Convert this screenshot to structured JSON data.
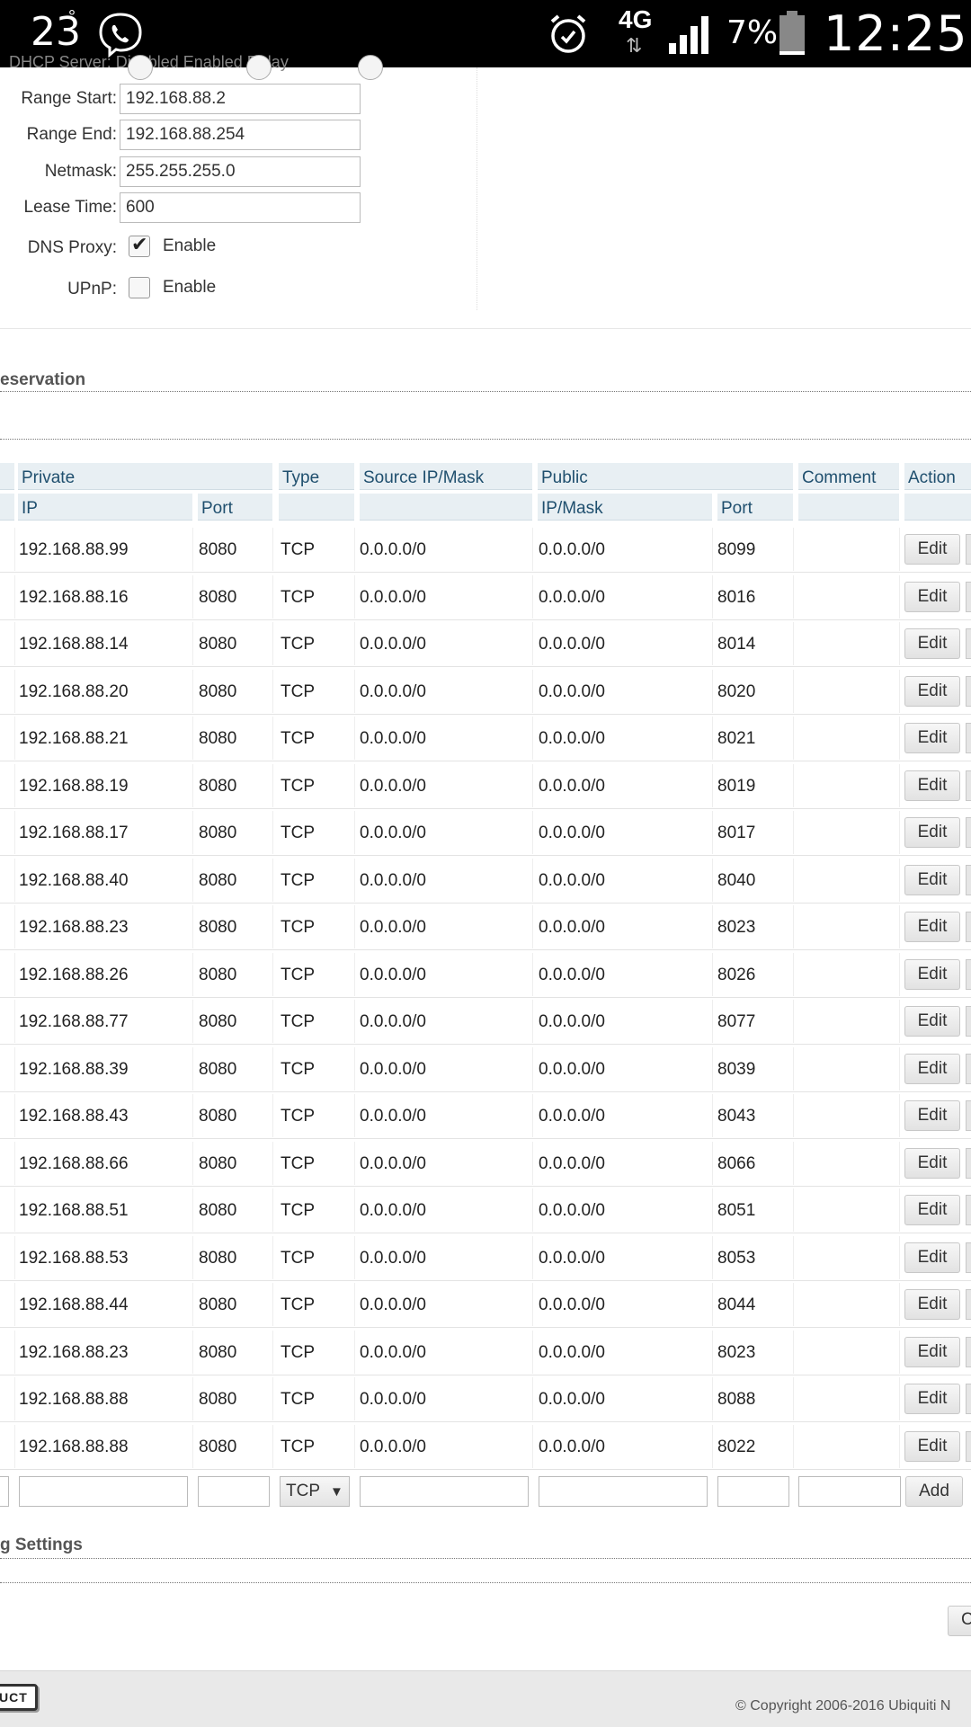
{
  "status_bar": {
    "temperature": "23",
    "degree": "°",
    "network": "4G",
    "network_arrows": "⇅",
    "battery_percent": "7%",
    "time": "12:25",
    "icons": [
      "viber-icon",
      "alarm-icon",
      "signal-icon",
      "battery-icon"
    ]
  },
  "dhcp": {
    "cut_row_text": "DHCP Server:   Disabled   Enabled   Relay",
    "fields": [
      {
        "label": "Range Start:",
        "value": "192.168.88.2"
      },
      {
        "label": "Range End:",
        "value": "192.168.88.254"
      },
      {
        "label": "Netmask:",
        "value": "255.255.255.0"
      },
      {
        "label": "Lease Time:",
        "value": "600"
      }
    ],
    "dns_proxy": {
      "label": "DNS Proxy:",
      "option": "Enable",
      "checked": true
    },
    "upnp": {
      "label": "UPnP:",
      "option": "Enable",
      "checked": false
    }
  },
  "reservation_title": "eservation",
  "settings_title": "g Settings",
  "table": {
    "headers_top": {
      "private": "Private",
      "type": "Type",
      "source": "Source IP/Mask",
      "public": "Public",
      "comment": "Comment",
      "action": "Action"
    },
    "headers_sub": {
      "ip": "IP",
      "port": "Port",
      "public_ip": "IP/Mask",
      "public_port": "Port"
    },
    "edit_label": "Edit",
    "rows": [
      {
        "ip": "192.168.88.99",
        "port": "8080",
        "type": "TCP",
        "source": "0.0.0.0/0",
        "public_ip": "0.0.0.0/0",
        "public_port": "8099"
      },
      {
        "ip": "192.168.88.16",
        "port": "8080",
        "type": "TCP",
        "source": "0.0.0.0/0",
        "public_ip": "0.0.0.0/0",
        "public_port": "8016"
      },
      {
        "ip": "192.168.88.14",
        "port": "8080",
        "type": "TCP",
        "source": "0.0.0.0/0",
        "public_ip": "0.0.0.0/0",
        "public_port": "8014"
      },
      {
        "ip": "192.168.88.20",
        "port": "8080",
        "type": "TCP",
        "source": "0.0.0.0/0",
        "public_ip": "0.0.0.0/0",
        "public_port": "8020"
      },
      {
        "ip": "192.168.88.21",
        "port": "8080",
        "type": "TCP",
        "source": "0.0.0.0/0",
        "public_ip": "0.0.0.0/0",
        "public_port": "8021"
      },
      {
        "ip": "192.168.88.19",
        "port": "8080",
        "type": "TCP",
        "source": "0.0.0.0/0",
        "public_ip": "0.0.0.0/0",
        "public_port": "8019"
      },
      {
        "ip": "192.168.88.17",
        "port": "8080",
        "type": "TCP",
        "source": "0.0.0.0/0",
        "public_ip": "0.0.0.0/0",
        "public_port": "8017"
      },
      {
        "ip": "192.168.88.40",
        "port": "8080",
        "type": "TCP",
        "source": "0.0.0.0/0",
        "public_ip": "0.0.0.0/0",
        "public_port": "8040"
      },
      {
        "ip": "192.168.88.23",
        "port": "8080",
        "type": "TCP",
        "source": "0.0.0.0/0",
        "public_ip": "0.0.0.0/0",
        "public_port": "8023"
      },
      {
        "ip": "192.168.88.26",
        "port": "8080",
        "type": "TCP",
        "source": "0.0.0.0/0",
        "public_ip": "0.0.0.0/0",
        "public_port": "8026"
      },
      {
        "ip": "192.168.88.77",
        "port": "8080",
        "type": "TCP",
        "source": "0.0.0.0/0",
        "public_ip": "0.0.0.0/0",
        "public_port": "8077"
      },
      {
        "ip": "192.168.88.39",
        "port": "8080",
        "type": "TCP",
        "source": "0.0.0.0/0",
        "public_ip": "0.0.0.0/0",
        "public_port": "8039"
      },
      {
        "ip": "192.168.88.43",
        "port": "8080",
        "type": "TCP",
        "source": "0.0.0.0/0",
        "public_ip": "0.0.0.0/0",
        "public_port": "8043"
      },
      {
        "ip": "192.168.88.66",
        "port": "8080",
        "type": "TCP",
        "source": "0.0.0.0/0",
        "public_ip": "0.0.0.0/0",
        "public_port": "8066"
      },
      {
        "ip": "192.168.88.51",
        "port": "8080",
        "type": "TCP",
        "source": "0.0.0.0/0",
        "public_ip": "0.0.0.0/0",
        "public_port": "8051"
      },
      {
        "ip": "192.168.88.53",
        "port": "8080",
        "type": "TCP",
        "source": "0.0.0.0/0",
        "public_ip": "0.0.0.0/0",
        "public_port": "8053"
      },
      {
        "ip": "192.168.88.44",
        "port": "8080",
        "type": "TCP",
        "source": "0.0.0.0/0",
        "public_ip": "0.0.0.0/0",
        "public_port": "8044"
      },
      {
        "ip": "192.168.88.23",
        "port": "8080",
        "type": "TCP",
        "source": "0.0.0.0/0",
        "public_ip": "0.0.0.0/0",
        "public_port": "8023"
      },
      {
        "ip": "192.168.88.88",
        "port": "8080",
        "type": "TCP",
        "source": "0.0.0.0/0",
        "public_ip": "0.0.0.0/0",
        "public_port": "8088"
      },
      {
        "ip": "192.168.88.88",
        "port": "8080",
        "type": "TCP",
        "source": "0.0.0.0/0",
        "public_ip": "0.0.0.0/0",
        "public_port": "8022"
      }
    ],
    "add_row": {
      "type_value": "TCP",
      "dropdown_arrow": "▼",
      "add_label": "Add"
    }
  },
  "cut_button_label": "C",
  "footer": {
    "logo_text": "UCT",
    "copyright": "© Copyright 2006-2016 Ubiquiti N"
  }
}
